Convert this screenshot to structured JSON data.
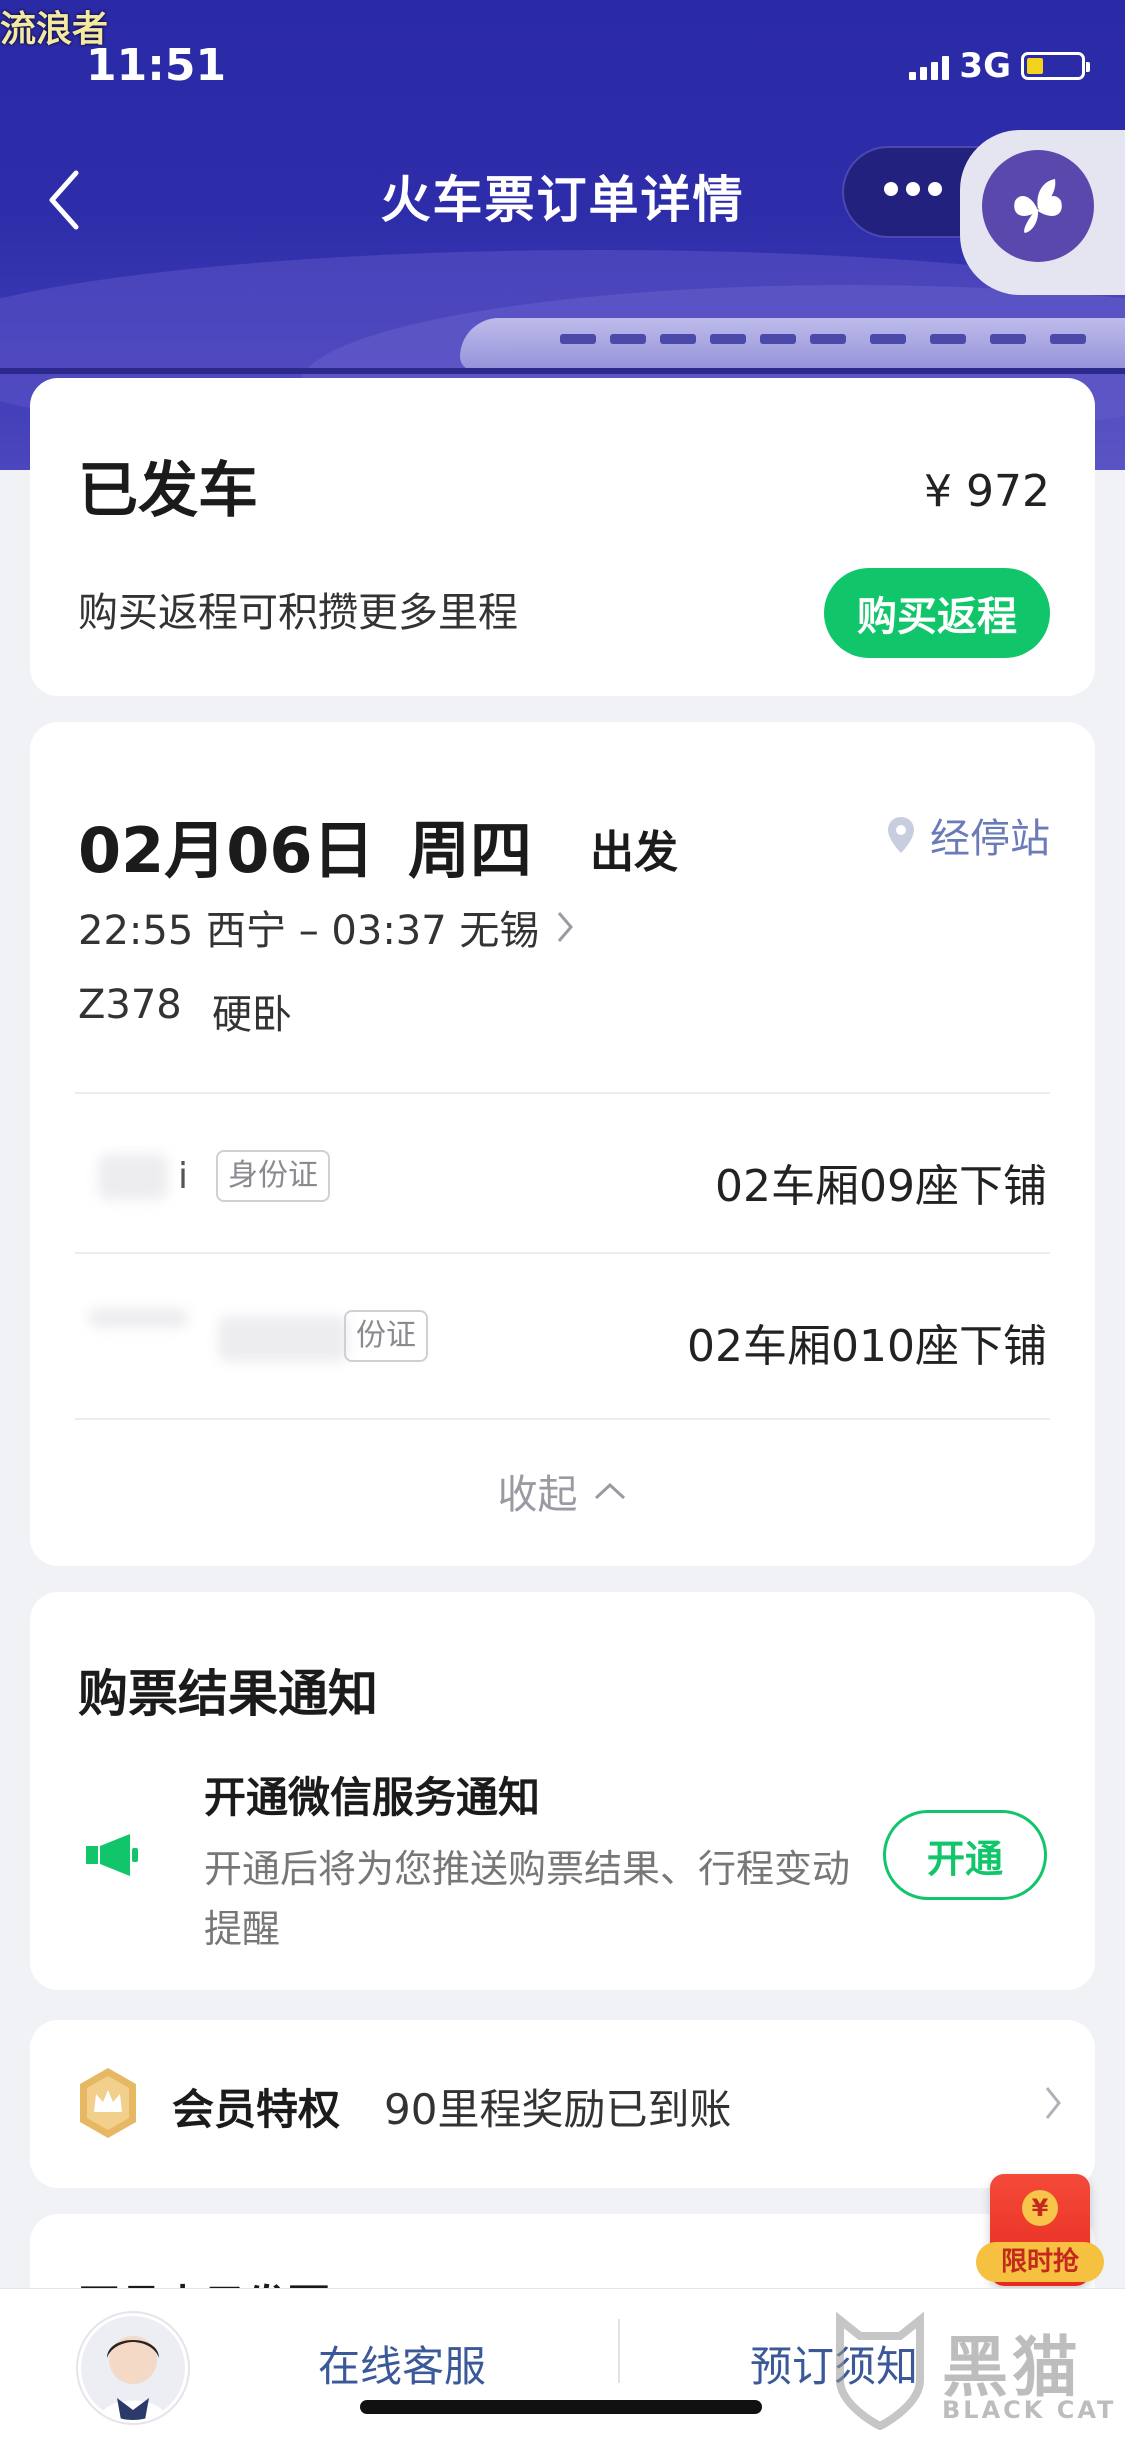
{
  "watermark": "流浪者",
  "status": {
    "time": "11:51",
    "network": "3G"
  },
  "nav": {
    "title": "火车票订单详情"
  },
  "order": {
    "status": "已发车",
    "price": "¥ 972",
    "promo_text": "购买返程可积攒更多里程",
    "return_button": "购买返程"
  },
  "trip": {
    "date": "02月06日",
    "weekday": "周四",
    "depart_label": "出发",
    "stops_link": "经停站",
    "route": "22:55 西宁 – 03:37 无锡",
    "train_no": "Z378",
    "seat_type": "硬卧",
    "passengers": [
      {
        "name_suffix": "i",
        "id_type": "身份证",
        "seat": "02车厢09座下铺"
      },
      {
        "id_type": "份证",
        "seat": "02车厢010座下铺"
      }
    ],
    "collapse_label": "收起"
  },
  "notify": {
    "title": "购票结果通知",
    "subtitle": "开通微信服务通知",
    "desc_line1": "开通后将为您推送购票结果、行程变动",
    "desc_line2": "提醒",
    "button": "开通"
  },
  "member": {
    "label": "会员特权",
    "reward": "90里程奖励已到账"
  },
  "next_section_partial": "开具电子发票",
  "promo_badge": {
    "label": "限时抢",
    "coin": "¥"
  },
  "bottom": {
    "service": "在线客服",
    "notice": "预订须知"
  },
  "logo": {
    "cn": "黑猫",
    "en": "BLACK CAT"
  },
  "colors": {
    "brand_purple": "#2e2da9",
    "green": "#11c56a",
    "link": "#6a7bb8"
  }
}
